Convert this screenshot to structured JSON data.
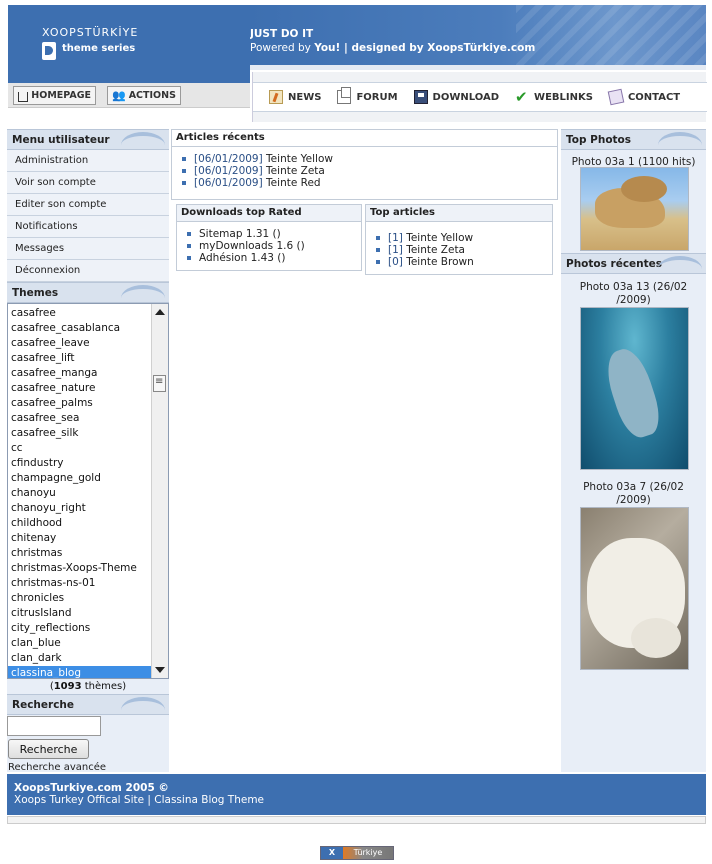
{
  "header": {
    "logo_line1": "XOOPSTÜRKİYE",
    "logo_line2": "theme series",
    "slogan": "JUST DO IT",
    "powered_prefix": "Powered by ",
    "powered_you": "You!",
    "powered_mid": " | designed by ",
    "powered_by": "XoopsTürkiye.com"
  },
  "top_buttons": {
    "home": "HOMEPAGE",
    "actions": "ACTIONS"
  },
  "nav": [
    {
      "label": "NEWS",
      "icon": "news-icon"
    },
    {
      "label": "FORUM",
      "icon": "forum-icon"
    },
    {
      "label": "DOWNLOAD",
      "icon": "download-icon"
    },
    {
      "label": "WEBLINKS",
      "icon": "checkmark-icon"
    },
    {
      "label": "CONTACT",
      "icon": "contact-icon"
    }
  ],
  "user_menu": {
    "title": "Menu utilisateur",
    "items": [
      "Administration",
      "Voir son compte",
      "Editer son compte",
      "Notifications",
      "Messages",
      "Déconnexion"
    ]
  },
  "themes": {
    "title": "Themes",
    "items": [
      "casafree",
      "casafree_casablanca",
      "casafree_leave",
      "casafree_lift",
      "casafree_manga",
      "casafree_nature",
      "casafree_palms",
      "casafree_sea",
      "casafree_silk",
      "cc",
      "cfindustry",
      "champagne_gold",
      "chanoyu",
      "chanoyu_right",
      "childhood",
      "chitenay",
      "christmas",
      "christmas-Xoops-Theme",
      "christmas-ns-01",
      "chronicles",
      "citrusIsland",
      "city_reflections",
      "clan_blue",
      "clan_dark",
      "classina_blog"
    ],
    "selected": "classina_blog",
    "count_open": "(",
    "count": "1093",
    "count_suffix": " thèmes)"
  },
  "search": {
    "title": "Recherche",
    "button": "Recherche",
    "advanced": "Recherche avancée",
    "value": ""
  },
  "recent_articles": {
    "title": "Articles récents",
    "items": [
      {
        "date": "[06/01/2009]",
        "text": " Teinte Yellow"
      },
      {
        "date": "[06/01/2009]",
        "text": " Teinte Zeta"
      },
      {
        "date": "[06/01/2009]",
        "text": " Teinte Red"
      }
    ]
  },
  "downloads": {
    "title": "Downloads top Rated",
    "items": [
      "Sitemap 1.31 ()",
      "myDownloads 1.6 ()",
      "Adhésion 1.43 ()"
    ]
  },
  "top_articles": {
    "title": "Top articles",
    "items": [
      {
        "count": "[1]",
        "text": " Teinte Yellow"
      },
      {
        "count": "[1]",
        "text": " Teinte Zeta"
      },
      {
        "count": "[0]",
        "text": " Teinte Brown"
      }
    ]
  },
  "top_photos": {
    "title": "Top Photos",
    "caption": "Photo 03a 1 (1100 hits)"
  },
  "recent_photos": {
    "title": "Photos récentes",
    "items": [
      {
        "line1": "Photo 03a 13 (26/02",
        "line2": "/2009)"
      },
      {
        "line1": "Photo 03a 7 (26/02",
        "line2": "/2009)"
      }
    ]
  },
  "footer": {
    "line1": "XoopsTurkiye.com 2005 ©",
    "line2": "Xoops Turkey Offical Site | Classina Blog Theme"
  },
  "badge": {
    "right": "Türkiye"
  },
  "colors": {
    "brand_blue": "#3d6fb0",
    "panel_bg": "#e8eef7",
    "selected": "#3d8ee5"
  }
}
